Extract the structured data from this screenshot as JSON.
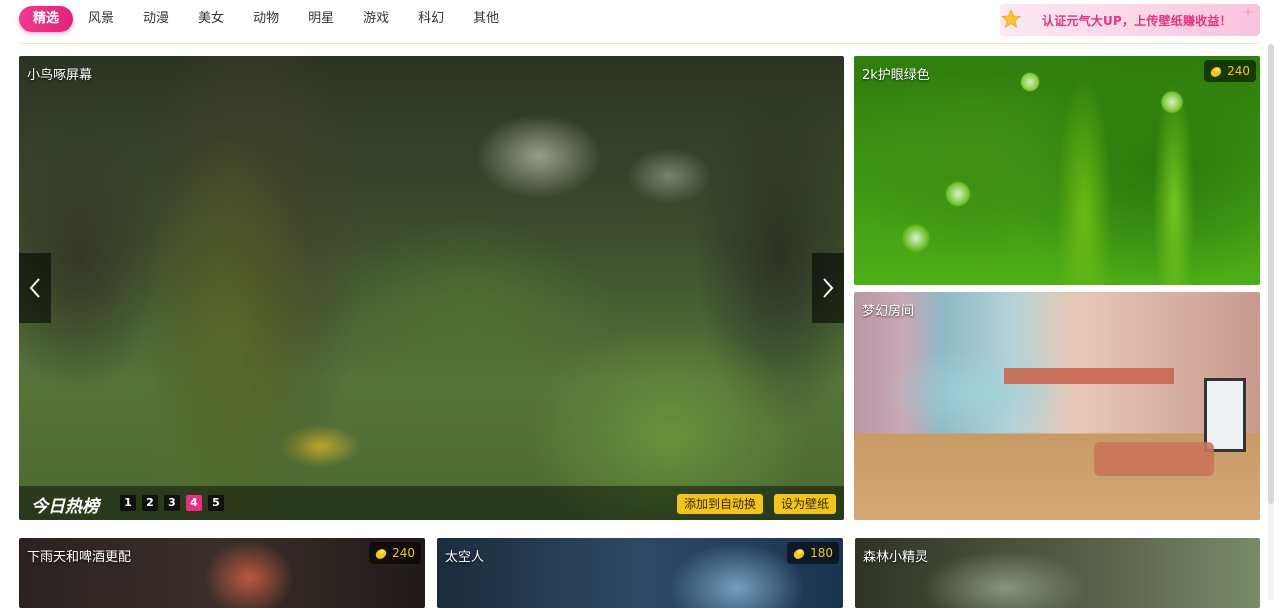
{
  "nav": {
    "tabs": [
      "精选",
      "风景",
      "动漫",
      "美女",
      "动物",
      "明星",
      "游戏",
      "科幻",
      "其他"
    ],
    "active_tab": "精选",
    "promo_text": "认证元气大UP，上传壁纸赚收益！"
  },
  "carousel": {
    "title": "小鸟啄屏幕",
    "section_label": "今日热榜",
    "pages": [
      "1",
      "2",
      "3",
      "4",
      "5"
    ],
    "active_page": "4",
    "add_auto_label": "添加到自动换",
    "set_wallpaper_label": "设为壁纸"
  },
  "cards": {
    "grass": {
      "title": "2k护眼绿色",
      "price": "240"
    },
    "room": {
      "title": "梦幻房间"
    },
    "rain": {
      "title": "下雨天和啤酒更配",
      "price": "240"
    },
    "astronaut": {
      "title": "太空人",
      "price": "180"
    },
    "forest": {
      "title": "森林小精灵"
    }
  },
  "colors": {
    "accent_pink": "#ea2d84",
    "button_yellow": "#f2c41c",
    "badge_gold": "#f5c518"
  },
  "icons": {
    "prev": "chevron-left-icon",
    "next": "chevron-right-icon",
    "coin": "coin-icon",
    "promo": "star-icon"
  }
}
